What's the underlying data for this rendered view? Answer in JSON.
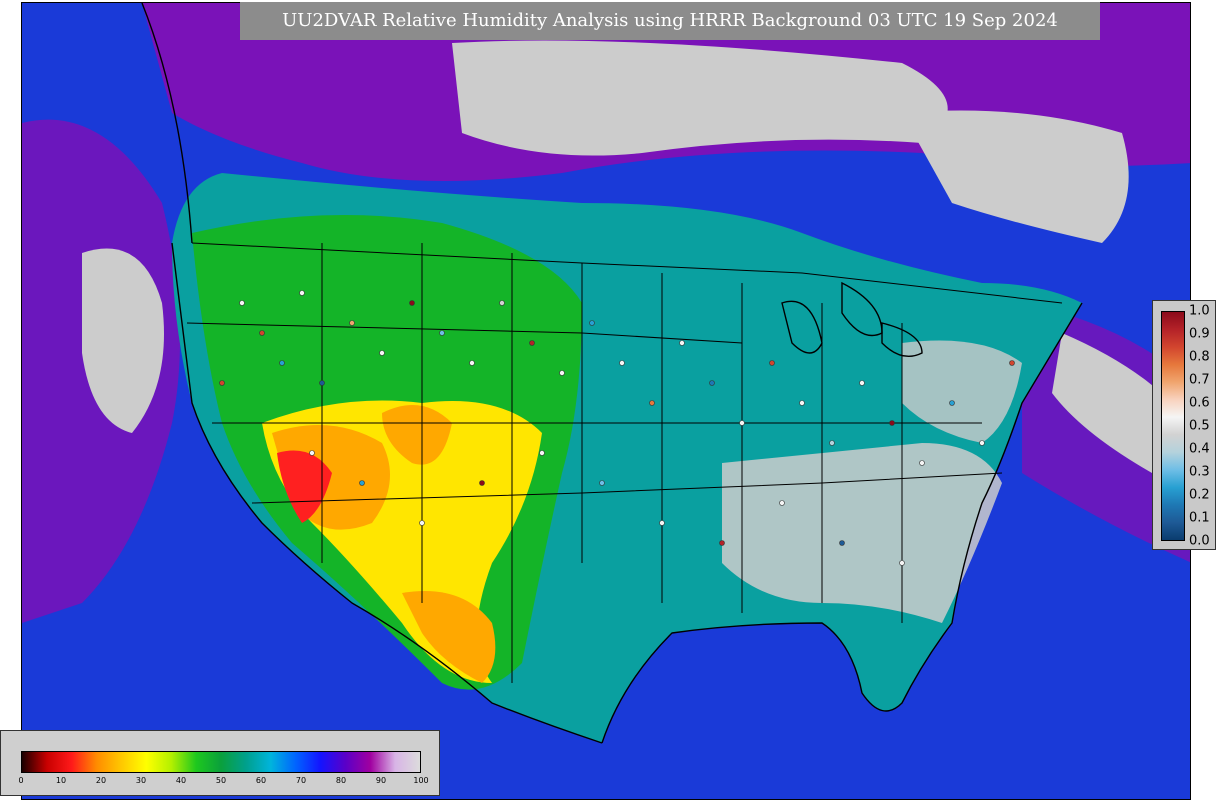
{
  "title": "UU2DVAR Relative Humidity Analysis using HRRR Background 03 UTC 19 Sep 2024",
  "rh_colorbar": {
    "ticks": [
      "0",
      "10",
      "20",
      "30",
      "40",
      "50",
      "60",
      "70",
      "80",
      "90",
      "100"
    ],
    "colors": [
      "#1a0000",
      "#c80000",
      "#ff1a1a",
      "#ff8c00",
      "#ffc800",
      "#ffff00",
      "#b4f000",
      "#1ec81e",
      "#0aa03c",
      "#00a08c",
      "#00b4dc",
      "#0064ff",
      "#1414ff",
      "#5a00c8",
      "#a000a0",
      "#d8b4e6",
      "#dcdcdc"
    ]
  },
  "obs_colorbar": {
    "ticks": [
      "1.0",
      "0.9",
      "0.8",
      "0.7",
      "0.6",
      "0.5",
      "0.4",
      "0.3",
      "0.2",
      "0.1",
      "0.0"
    ],
    "colors": [
      "#8b0a1a",
      "#b42228",
      "#d2452e",
      "#e6783c",
      "#f0a56e",
      "#f8d2be",
      "#f5f5f5",
      "#d2d2d2",
      "#b4d2dc",
      "#6ebee6",
      "#28a0d2",
      "#1e78b4",
      "#1e5a96",
      "#0a3c6e"
    ]
  },
  "map_colors": {
    "ocean_blue": "#1a3ad8",
    "deep_purple": "#7a12b8",
    "light_gray": "#cccccc",
    "teal": "#0aa0a0",
    "green": "#14b428",
    "yellow": "#ffe600",
    "orange": "#ffa800",
    "red": "#ff2020",
    "boundary": "#000000"
  }
}
